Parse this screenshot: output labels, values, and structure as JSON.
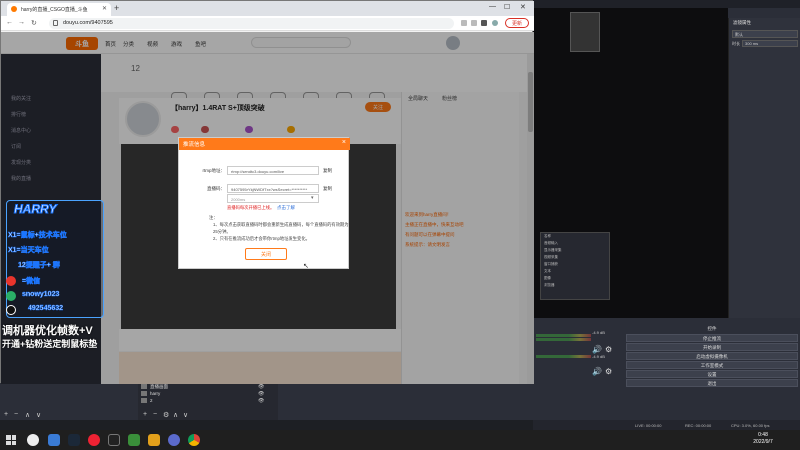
{
  "browser": {
    "tab_title": "harry的直播_CSGO直播_斗鱼",
    "url": "douyu.com/9407595",
    "update_label": "更新"
  },
  "site": {
    "nav": [
      "首页",
      "分类",
      "视频",
      "游戏",
      "鱼吧"
    ],
    "sidebar": [
      "我的关注",
      "排行榜",
      "消息中心",
      "订阅",
      "发现分类",
      "我的直播"
    ],
    "icons": [
      "首页",
      "关注",
      "我的",
      "排行",
      "任务",
      "签到",
      "消息",
      "抽奖",
      "鱼丸",
      "福利"
    ],
    "badge_number": "12",
    "room_title": "【harry】1.4RAT S+顶级突破",
    "follow_label": "关注",
    "right_tabs": [
      "全局聊天",
      "粉丝榜"
    ],
    "chat_lines": [
      "欢迎来到harry直播间！",
      "主播正在直播中，快来互动吧",
      "有问题可以在弹幕中提问",
      "系统提示：请文明发言"
    ]
  },
  "dialog": {
    "title": "推流信息",
    "close": "×",
    "rtmp_label": "rtmp地址：",
    "rtmp_value": "rtmp://sendtc3.douyu.com/live",
    "copy1": "复制",
    "key_label": "直播码：",
    "key_value": "9407595rYkjNWDfTxx?wsSecret=**********",
    "copy2": "复制",
    "select_value": "2000ms",
    "warn": "直播码每次开播已上线。",
    "learn": "点击了解",
    "note_title": "注：",
    "note1": "1、每次点击获取直播码时都会重新生成直播码，每个直播码的有效期为25分钟。",
    "note2": "2、只有在推流成功后才会带你rtmp地址发生变化。",
    "close_btn": "关闭"
  },
  "overlay": {
    "brand": "HARRY",
    "line1": "X1=鼠标+技术车位",
    "line2": "X1=当天车位",
    "line3": "12提醒子+ 群",
    "line4": "=微信",
    "line5": "snowy1023",
    "line6": "492545632",
    "caption1": "调机器优化帧数+V",
    "caption2": "开通+钻粉送定制鼠标垫"
  },
  "obs": {
    "props_title": "滤镜属性",
    "props_select": "默认",
    "delay_label": "时长",
    "delay_value": "300 ms",
    "mixer_db1": "-4.9 dB",
    "mixer_db2": "-4.9 dB",
    "mixer_db3": "-4.9 dB",
    "controls_title": "控件",
    "controls": [
      "停止推流",
      "开始录制",
      "启动虚拟摄像机",
      "工作室模式",
      "设置",
      "退出"
    ],
    "scenes": [
      "直播画面",
      "harry",
      "2"
    ],
    "mini_list": [
      "名称",
      "音频输入",
      "显示器采集",
      "视频采集",
      "窗口捕获",
      "文本",
      "图像",
      "浏览器"
    ],
    "status": {
      "live": "LIVE: 00:00:00",
      "rec": "REC: 00:00:00",
      "cpu": "CPU: 3.0%, 60.00 fps",
      "kbps": "kb/s: 0"
    }
  },
  "taskbar": {
    "time": "0:48",
    "date": "2022/9/7"
  }
}
